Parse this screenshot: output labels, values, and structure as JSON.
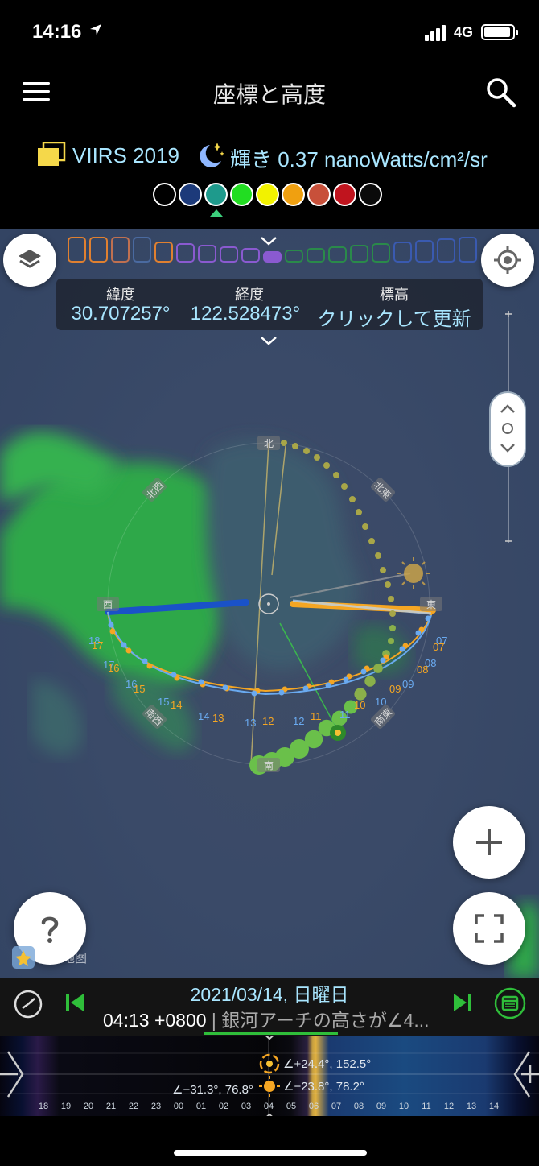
{
  "status_bar": {
    "time": "14:16",
    "network": "4G"
  },
  "header": {
    "title": "座標と高度"
  },
  "info": {
    "layer_label": "VIIRS 2019",
    "brightness_label": "輝き 0.37 nanoWatts/cm²/sr",
    "swatches": [
      "#000000",
      "#1c3a7a",
      "#1e9a8c",
      "#22dd22",
      "#f2f200",
      "#f0a010",
      "#c8503a",
      "#c0141e",
      "#0a0a0a"
    ],
    "selected_swatch_index": 2
  },
  "coordinates": {
    "lat_label": "緯度",
    "lat_value": "30.707257°",
    "lng_label": "経度",
    "lng_value": "122.528473°",
    "elev_label": "標高",
    "elev_value": "クリックして更新"
  },
  "compass": {
    "north": "北",
    "south": "南",
    "east": "東",
    "west": "西",
    "northeast": "北東",
    "northwest": "北西",
    "southeast": "南東",
    "southwest": "南西"
  },
  "hour_labels_blue": [
    "18",
    "17",
    "16",
    "15",
    "14",
    "13",
    "12",
    "11",
    "10",
    "09",
    "08",
    "07"
  ],
  "hour_labels_orange": [
    "17",
    "16",
    "15",
    "14",
    "13",
    "12",
    "11",
    "10",
    "09",
    "08",
    "07"
  ],
  "watermark": "高德地图",
  "timebar": {
    "date": "2021/03/14, 日曜日",
    "time": "04:13 +0800",
    "note": " | 銀河アーチの高さが∠4..."
  },
  "timeline": {
    "hours": [
      "18",
      "19",
      "20",
      "21",
      "22",
      "23",
      "00",
      "01",
      "02",
      "03",
      "04",
      "05",
      "06",
      "07",
      "08",
      "09",
      "10",
      "11",
      "12",
      "13",
      "14"
    ],
    "galaxy_readout": "∠+24.4°, 152.5°",
    "moon_readout": "∠−31.3°, 76.8°",
    "sun_readout": "∠−23.8°, 78.2°"
  },
  "colors": {
    "accent_cyan": "#a9e6ff",
    "accent_green": "#2fbe3a",
    "sun_line": "#f5a623",
    "moon_line": "#2a6fd6"
  }
}
